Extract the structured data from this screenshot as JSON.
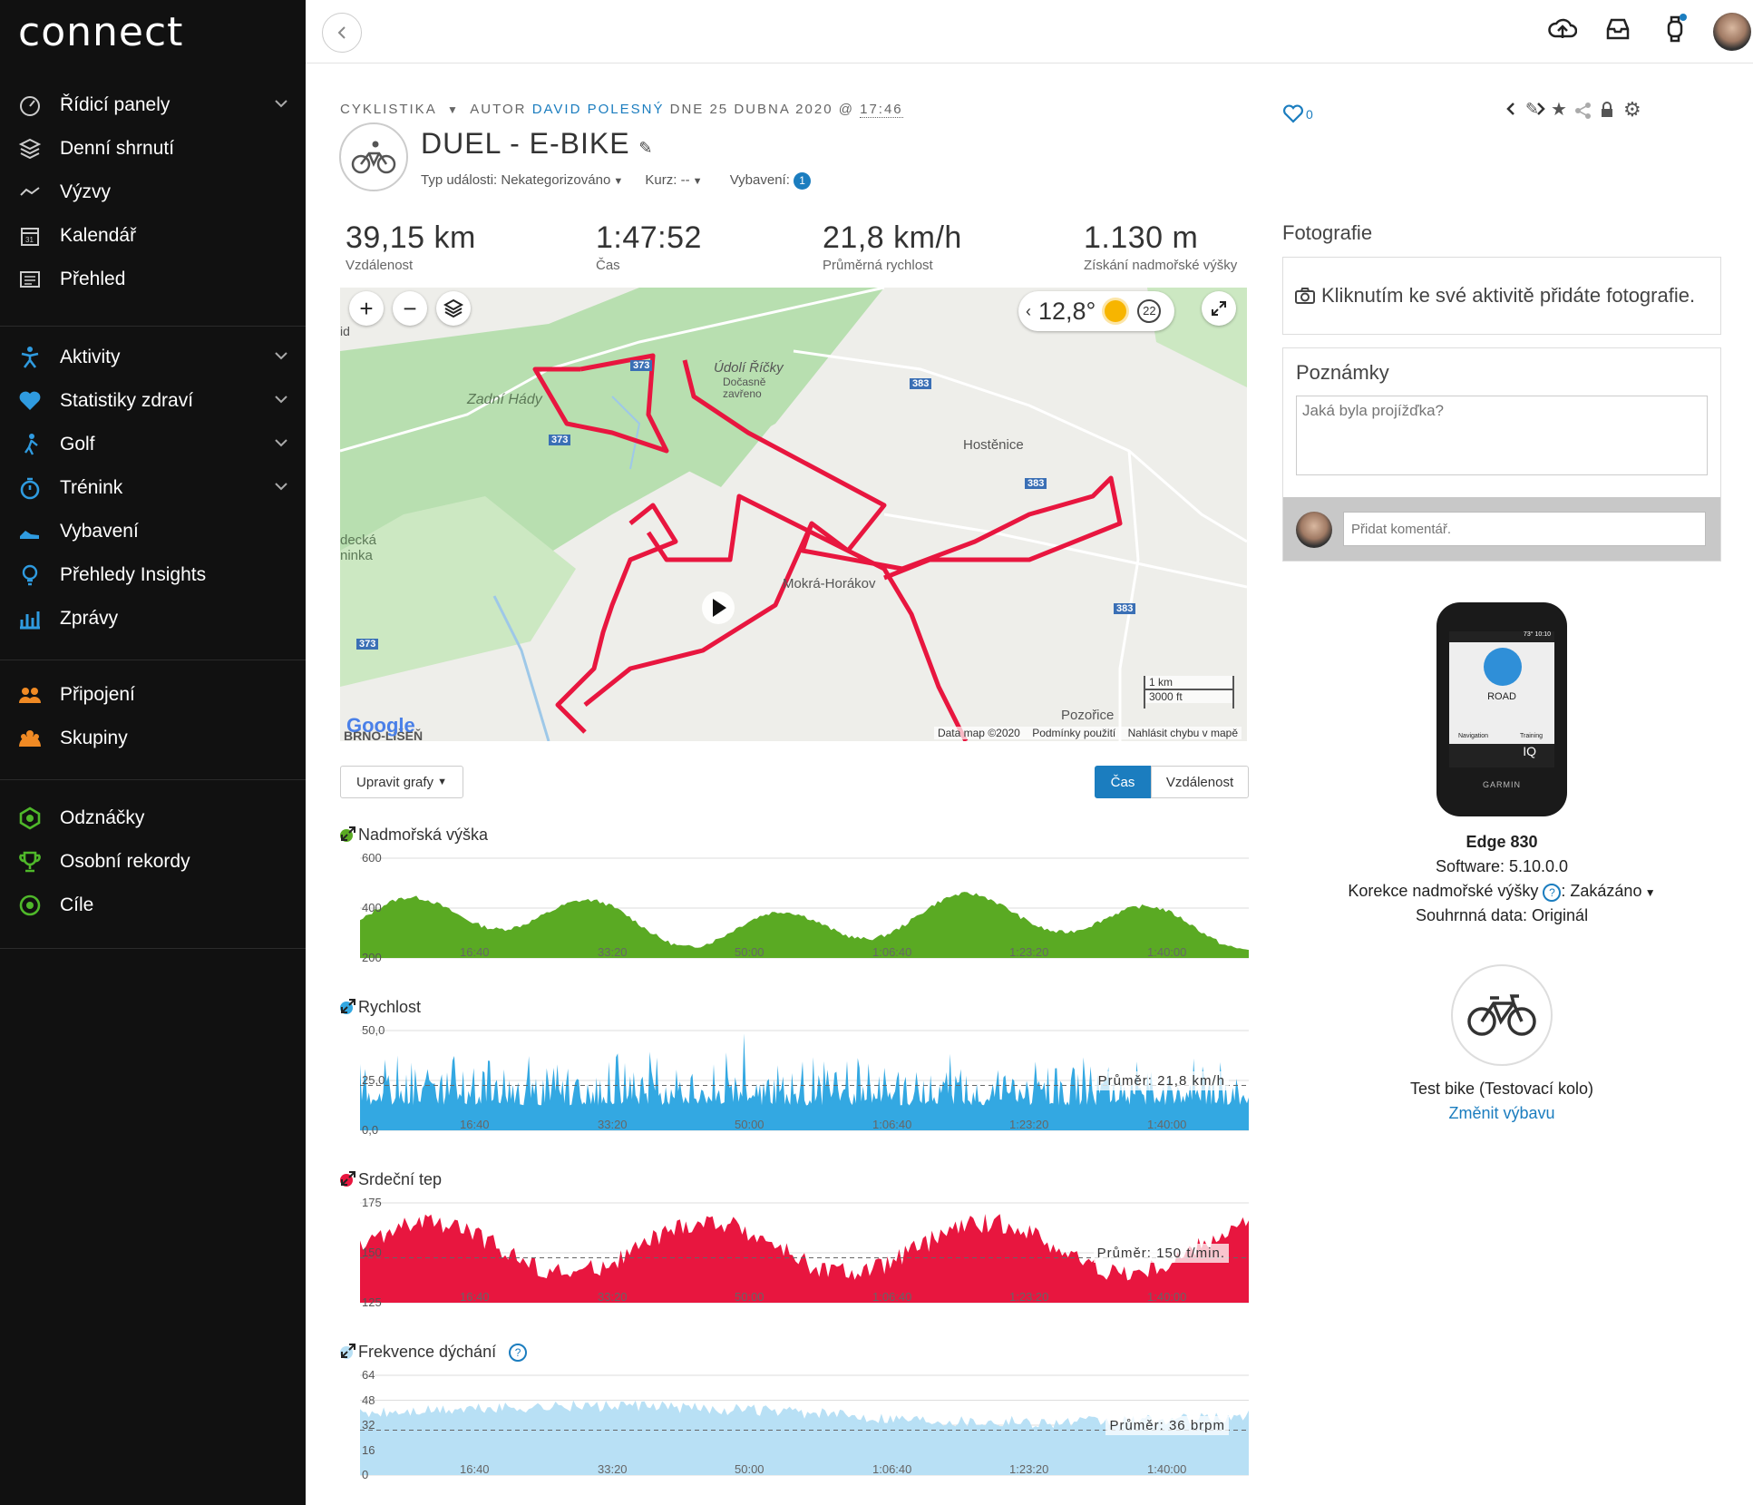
{
  "app": {
    "logo": "connect"
  },
  "sidebar": {
    "group1": [
      {
        "label": "Řídicí panely",
        "icon": "dashboard-icon",
        "chev": true
      },
      {
        "label": "Denní shrnutí",
        "icon": "layers-icon",
        "chev": false
      },
      {
        "label": "Výzvy",
        "icon": "challenges-icon",
        "chev": false
      },
      {
        "label": "Kalendář",
        "icon": "calendar-icon",
        "chev": false
      },
      {
        "label": "Přehled",
        "icon": "newsfeed-icon",
        "chev": false
      }
    ],
    "group2": [
      {
        "label": "Aktivity",
        "icon": "activities-icon",
        "chev": true
      },
      {
        "label": "Statistiky zdraví",
        "icon": "heart-icon",
        "chev": true
      },
      {
        "label": "Golf",
        "icon": "golf-icon",
        "chev": true
      },
      {
        "label": "Trénink",
        "icon": "stopwatch-icon",
        "chev": true
      },
      {
        "label": "Vybavení",
        "icon": "shoe-icon",
        "chev": false
      },
      {
        "label": "Přehledy Insights",
        "icon": "lightbulb-icon",
        "chev": false
      },
      {
        "label": "Zprávy",
        "icon": "reports-icon",
        "chev": false
      }
    ],
    "group3": [
      {
        "label": "Připojení",
        "icon": "connections-icon",
        "chev": false
      },
      {
        "label": "Skupiny",
        "icon": "groups-icon",
        "chev": false
      }
    ],
    "group4": [
      {
        "label": "Odznáčky",
        "icon": "badge-icon",
        "chev": false
      },
      {
        "label": "Osobní rekordy",
        "icon": "trophy-icon",
        "chev": false
      },
      {
        "label": "Cíle",
        "icon": "goal-icon",
        "chev": false
      }
    ]
  },
  "activity": {
    "category": "CYKLISTIKA",
    "author_prefix": "AUTOR",
    "author": "DAVID POLESNÝ",
    "date": "DNE 25 DUBNA 2020 @",
    "time": "17:46",
    "title": "DUEL - E-BIKE",
    "event_type": "Typ události: Nekategorizováno",
    "course": "Kurz: --",
    "gear": "Vybavení:",
    "gear_count": "1",
    "likes": "0"
  },
  "stats": [
    {
      "value": "39,15 km",
      "label": "Vzdálenost"
    },
    {
      "value": "1:47:52",
      "label": "Čas"
    },
    {
      "value": "21,8 km/h",
      "label": "Průměrná rychlost"
    },
    {
      "value": "1.130 m",
      "label": "Získání nadmořské výšky"
    }
  ],
  "map": {
    "temp": "12,8°",
    "wind": "22",
    "labels": [
      "Údolí Říčky",
      "Dočasně",
      "zavřeno",
      "Zadní Hády",
      "Hostěnice",
      "Mokrá-Horákov",
      "Pozořice",
      "decká",
      "ninka",
      "BRNO-LÍŠEŇ",
      "id"
    ],
    "roads": [
      "373",
      "383",
      "373",
      "383",
      "383",
      "373"
    ],
    "scale_km": "1 km",
    "scale_ft": "3000 ft",
    "attribution": [
      "Data map ©2020",
      "Podmínky použití",
      "Nahlásit chybu v mapě"
    ],
    "google": "Google"
  },
  "controls": {
    "edit_charts": "Upravit grafy",
    "tab_time": "Čas",
    "tab_distance": "Vzdálenost"
  },
  "charts": [
    {
      "title": "Nadmořská výška",
      "color": "#5aaa23",
      "yticks": [
        "600",
        "400",
        "200"
      ],
      "xticks": [
        "16:40",
        "33:20",
        "50:00",
        "1:06:40",
        "1:23:20",
        "1:40:00"
      ],
      "avg": ""
    },
    {
      "title": "Rychlost",
      "color": "#33a8e2",
      "yticks": [
        "50,0",
        "25,0",
        "0,0"
      ],
      "xticks": [
        "16:40",
        "33:20",
        "50:00",
        "1:06:40",
        "1:23:20",
        "1:40:00"
      ],
      "avg": "Průměr: 21,8 km/h"
    },
    {
      "title": "Srdeční tep",
      "color": "#e8163f",
      "yticks": [
        "175",
        "150",
        "125"
      ],
      "xticks": [
        "16:40",
        "33:20",
        "50:00",
        "1:06:40",
        "1:23:20",
        "1:40:00"
      ],
      "avg": "Průměr: 150 t/min."
    },
    {
      "title": "Frekvence dýchání",
      "color": "#b8e0f5",
      "yticks": [
        "64",
        "48",
        "32",
        "16",
        "0"
      ],
      "xticks": [
        "16:40",
        "33:20",
        "50:00",
        "1:06:40",
        "1:23:20",
        "1:40:00"
      ],
      "avg": "Průměr: 36 brpm"
    }
  ],
  "right": {
    "photos_title": "Fotografie",
    "photos_cta": "Kliknutím ke své aktivitě přidáte fotografie.",
    "notes_title": "Poznámky",
    "notes_placeholder": "Jaká byla projížďka?",
    "comment_placeholder": "Přidat komentář.",
    "device_name": "Edge 830",
    "software": "Software: 5.10.0.0",
    "elev_corr": "Korekce nadmořské výšky",
    "elev_corr_val": ": Zakázáno",
    "summary": "Souhrnná data: Originál",
    "bike_name": "Test bike (Testovací kolo)",
    "change_gear": "Změnit výbavu",
    "device_screen": {
      "mode": "ROAD",
      "nav": "Navigation",
      "training": "Training",
      "iq": "IQ",
      "brand": "GARMIN",
      "temp": "73°",
      "clock": "10:10"
    }
  }
}
